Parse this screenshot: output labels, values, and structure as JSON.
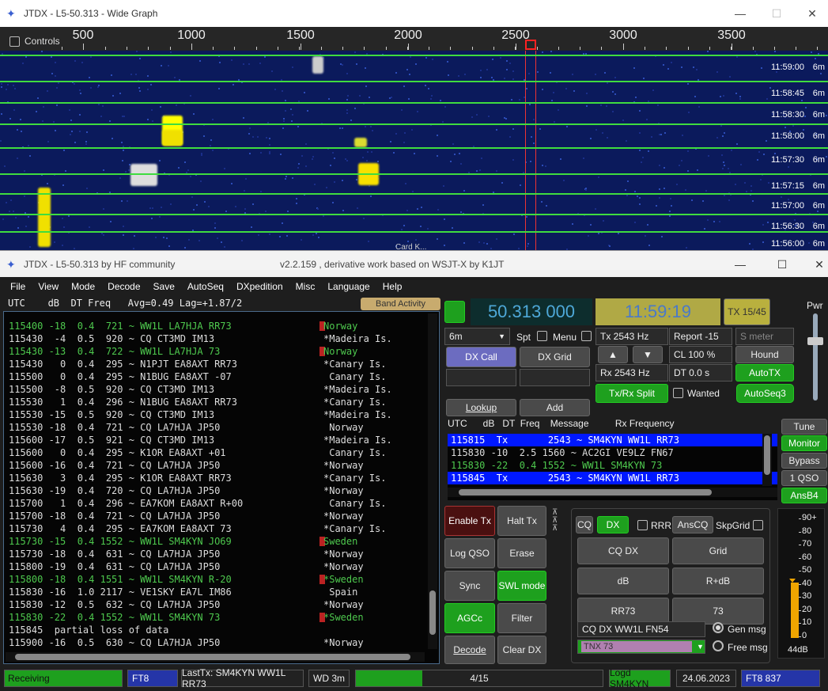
{
  "wide_graph": {
    "title": "JTDX - L5-50.313 - Wide Graph",
    "controls_label": "Controls",
    "scale_labels": [
      "500",
      "1000",
      "1500",
      "2000",
      "2500",
      "3000",
      "3500"
    ],
    "times": [
      "11:59:00",
      "11:58:45",
      "11:58:30",
      "11:58:00",
      "11:57:30",
      "11:57:15",
      "11:57:00",
      "11:56:30",
      "11:56:00"
    ],
    "band": "6m",
    "bottom_text": "Card K..."
  },
  "main": {
    "title": "JTDX - L5-50.313  by HF community",
    "subtitle": "v2.2.159 , derivative work based on WSJT-X by K1JT"
  },
  "menu": [
    "File",
    "View",
    "Mode",
    "Decode",
    "Save",
    "AutoSeq",
    "DXpedition",
    "Misc",
    "Language",
    "Help"
  ],
  "band_header": "UTC    dB  DT Freq   Avg=0.49 Lag=+1.87/2",
  "band_activity_btn": "Band Activity",
  "band_rows": [
    {
      "t": "115400 -18  0.4  721 ~ WW1L LA7HJA RR73",
      "c": "Norway",
      "col": "#4ec94e",
      "flag": true
    },
    {
      "t": "115430  -4  0.5  920 ~ CQ CT3MD IM13",
      "c": "*Madeira Is.",
      "col": "#ddd"
    },
    {
      "t": "115430 -13  0.4  722 ~ WW1L LA7HJA 73",
      "c": "Norway",
      "col": "#4ec94e",
      "flag": true
    },
    {
      "t": "115430   0  0.4  295 ~ N1PJT EA8AXT RR73",
      "c": "*Canary Is.",
      "col": "#ddd"
    },
    {
      "t": "115500   0  0.4  295 ~ N1BUG EA8AXT -07",
      "c": " Canary Is.",
      "col": "#ddd"
    },
    {
      "t": "115500  -8  0.5  920 ~ CQ CT3MD IM13",
      "c": "*Madeira Is.",
      "col": "#ddd"
    },
    {
      "t": "115530   1  0.4  296 ~ N1BUG EA8AXT RR73",
      "c": "*Canary Is.",
      "col": "#ddd"
    },
    {
      "t": "115530 -15  0.5  920 ~ CQ CT3MD IM13",
      "c": "*Madeira Is.",
      "col": "#ddd"
    },
    {
      "t": "115530 -18  0.4  721 ~ CQ LA7HJA JP50",
      "c": " Norway",
      "col": "#ddd"
    },
    {
      "t": "115600 -17  0.5  921 ~ CQ CT3MD IM13",
      "c": "*Madeira Is.",
      "col": "#ddd"
    },
    {
      "t": "115600   0  0.4  295 ~ K1OR EA8AXT +01",
      "c": " Canary Is.",
      "col": "#ddd"
    },
    {
      "t": "115600 -16  0.4  721 ~ CQ LA7HJA JP50",
      "c": "*Norway",
      "col": "#ddd"
    },
    {
      "t": "115630   3  0.4  295 ~ K1OR EA8AXT RR73",
      "c": "*Canary Is.",
      "col": "#ddd"
    },
    {
      "t": "115630 -19  0.4  720 ~ CQ LA7HJA JP50",
      "c": "*Norway",
      "col": "#ddd"
    },
    {
      "t": "115700   1  0.4  296 ~ EA7KOM EA8AXT R+00",
      "c": " Canary Is.",
      "col": "#ddd"
    },
    {
      "t": "115700 -18  0.4  721 ~ CQ LA7HJA JP50",
      "c": "*Norway",
      "col": "#ddd"
    },
    {
      "t": "115730   4  0.4  295 ~ EA7KOM EA8AXT 73",
      "c": "*Canary Is.",
      "col": "#ddd"
    },
    {
      "t": "115730 -15  0.4 1552 ~ WW1L SM4KYN JO69",
      "c": "Sweden",
      "col": "#4ec94e",
      "flag": true
    },
    {
      "t": "115730 -18  0.4  631 ~ CQ LA7HJA JP50",
      "c": "*Norway",
      "col": "#ddd"
    },
    {
      "t": "115800 -19  0.4  631 ~ CQ LA7HJA JP50",
      "c": "*Norway",
      "col": "#ddd"
    },
    {
      "t": "115800 -18  0.4 1551 ~ WW1L SM4KYN R-20",
      "c": "*Sweden",
      "col": "#4ec94e",
      "flag": true
    },
    {
      "t": "115830 -16  1.0 2117 ~ VE1SKY EA7L IM86",
      "c": " Spain",
      "col": "#ddd"
    },
    {
      "t": "115830 -12  0.5  632 ~ CQ LA7HJA JP50",
      "c": "*Norway",
      "col": "#ddd"
    },
    {
      "t": "115830 -22  0.4 1552 ~ WW1L SM4KYN 73",
      "c": "*Sweden",
      "col": "#4ec94e",
      "flag": true
    },
    {
      "t": "115845  partial loss of data",
      "c": "",
      "col": "#ddd"
    },
    {
      "t": "115900 -16  0.5  630 ~ CQ LA7HJA JP50",
      "c": "*Norway",
      "col": "#ddd"
    }
  ],
  "freq": "50.313 000",
  "clock": "11:59:19",
  "tx_slot": "TX 15/45",
  "pwr": "Pwr",
  "band_select": "6m",
  "spt": "Spt",
  "menu_label": "Menu",
  "tx_hz": "Tx  2543 Hz",
  "rx_hz": "Rx  2543 Hz",
  "report": "Report -15",
  "s_meter": "S meter",
  "cl": "CL  100 %",
  "dt": "DT 0.0 s",
  "hound": "Hound",
  "autotx": "AutoTX",
  "wanted": "Wanted",
  "autoseq3": "AutoSeq3",
  "dx_call": "DX Call",
  "dx_grid": "DX Grid",
  "lookup": "Lookup",
  "add": "Add",
  "txrx_split": "Tx/Rx Split",
  "rx_header": "UTC      dB   DT  Freq    Message          Rx Frequency",
  "rx_rows": [
    {
      "t": "115815  Tx       2543 ~ SM4KYN WW1L RR73",
      "hl": true,
      "col": "#fff"
    },
    {
      "t": "115830 -10  2.5 1560 ~ AC2GI VE9LZ FN67",
      "hl": false,
      "col": "#ddd"
    },
    {
      "t": "115830 -22  0.4 1552 ~ WW1L SM4KYN 73",
      "hl": false,
      "col": "#4ec94e"
    },
    {
      "t": "115845  Tx       2543 ~ SM4KYN WW1L RR73",
      "hl": true,
      "col": "#fff"
    }
  ],
  "right_btns": [
    "Tune",
    "Monitor",
    "Bypass",
    "1 QSO",
    "AnsB4"
  ],
  "enable_tx": "Enable Tx",
  "halt_tx": "Halt Tx",
  "log_qso": "Log QSO",
  "erase": "Erase",
  "sync": "Sync",
  "swl": "SWL mode",
  "agcc": "AGCc",
  "filter": "Filter",
  "decode": "Decode",
  "clear_dx": "Clear DX",
  "cq": "CQ",
  "dx": "DX",
  "rrr": "RRR",
  "anscq": "AnsCQ",
  "skpgrid": "SkpGrid",
  "msg_btns": [
    "CQ DX",
    "Grid",
    "dB",
    "R+dB",
    "RR73",
    "73"
  ],
  "gen_msg_text": "CQ DX WW1L FN54",
  "tx_msg": "TNX 73",
  "gen_msg": "Gen msg",
  "free_msg": "Free msg",
  "meter_scale": [
    "90+",
    "80",
    "70",
    "60",
    "50",
    "40",
    "30",
    "20",
    "10",
    "0"
  ],
  "meter_db": "44dB",
  "status": {
    "receiving": "Receiving",
    "mode": "FT8",
    "lasttx": "LastTx: SM4KYN WW1L RR73",
    "wd": "WD 3m",
    "progress": "4/15",
    "logd": "Logd SM4KYN",
    "date": "24.06.2023",
    "mode2": "FT8  837"
  }
}
